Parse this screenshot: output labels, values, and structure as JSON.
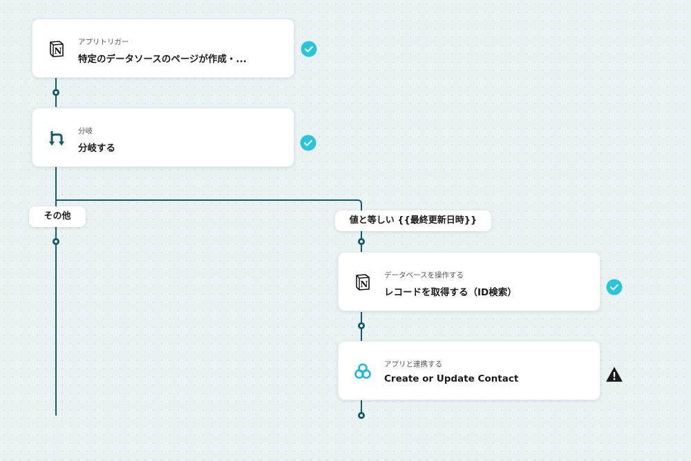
{
  "flow": {
    "steps": [
      {
        "subtitle": "アプリトリガー",
        "title": "特定のデータソースのページが作成・...",
        "icon": "notion-icon",
        "status": "success-check-icon"
      },
      {
        "subtitle": "分岐",
        "title": "分岐する",
        "icon": "branch-icon",
        "status": "success-check-icon"
      },
      {
        "subtitle": "データベースを操作する",
        "title": "レコードを取得する（ID検索）",
        "icon": "notion-icon",
        "status": "success-check-icon"
      },
      {
        "subtitle": "アプリと連携する",
        "title": "Create or Update Contact",
        "icon": "app-integration-icon",
        "status": "warning-icon"
      }
    ],
    "branches": {
      "other": "その他",
      "equals": "値と等しい {{最終更新日時}}"
    }
  },
  "colors": {
    "connector": "#0f5a6e",
    "success": "#2bc4d8",
    "warning": "#1a1a1a",
    "app_icon": "#1ab4e6"
  }
}
